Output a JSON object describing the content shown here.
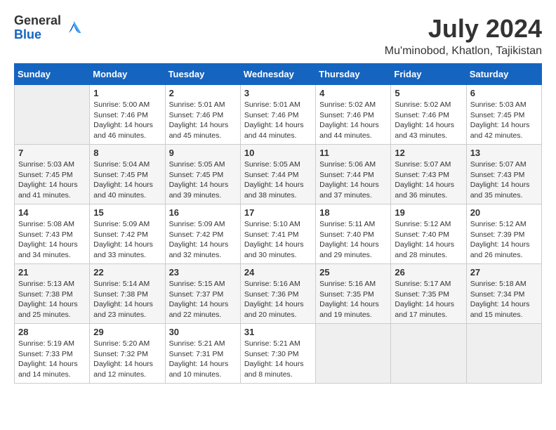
{
  "header": {
    "logo_general": "General",
    "logo_blue": "Blue",
    "month_year": "July 2024",
    "location": "Mu'minobod, Khatlon, Tajikistan"
  },
  "days_of_week": [
    "Sunday",
    "Monday",
    "Tuesday",
    "Wednesday",
    "Thursday",
    "Friday",
    "Saturday"
  ],
  "weeks": [
    [
      {
        "day": "",
        "empty": true
      },
      {
        "day": "1",
        "sunrise": "5:00 AM",
        "sunset": "7:46 PM",
        "daylight": "14 hours and 46 minutes."
      },
      {
        "day": "2",
        "sunrise": "5:01 AM",
        "sunset": "7:46 PM",
        "daylight": "14 hours and 45 minutes."
      },
      {
        "day": "3",
        "sunrise": "5:01 AM",
        "sunset": "7:46 PM",
        "daylight": "14 hours and 44 minutes."
      },
      {
        "day": "4",
        "sunrise": "5:02 AM",
        "sunset": "7:46 PM",
        "daylight": "14 hours and 44 minutes."
      },
      {
        "day": "5",
        "sunrise": "5:02 AM",
        "sunset": "7:46 PM",
        "daylight": "14 hours and 43 minutes."
      },
      {
        "day": "6",
        "sunrise": "5:03 AM",
        "sunset": "7:45 PM",
        "daylight": "14 hours and 42 minutes."
      }
    ],
    [
      {
        "day": "7",
        "sunrise": "5:03 AM",
        "sunset": "7:45 PM",
        "daylight": "14 hours and 41 minutes."
      },
      {
        "day": "8",
        "sunrise": "5:04 AM",
        "sunset": "7:45 PM",
        "daylight": "14 hours and 40 minutes."
      },
      {
        "day": "9",
        "sunrise": "5:05 AM",
        "sunset": "7:45 PM",
        "daylight": "14 hours and 39 minutes."
      },
      {
        "day": "10",
        "sunrise": "5:05 AM",
        "sunset": "7:44 PM",
        "daylight": "14 hours and 38 minutes."
      },
      {
        "day": "11",
        "sunrise": "5:06 AM",
        "sunset": "7:44 PM",
        "daylight": "14 hours and 37 minutes."
      },
      {
        "day": "12",
        "sunrise": "5:07 AM",
        "sunset": "7:43 PM",
        "daylight": "14 hours and 36 minutes."
      },
      {
        "day": "13",
        "sunrise": "5:07 AM",
        "sunset": "7:43 PM",
        "daylight": "14 hours and 35 minutes."
      }
    ],
    [
      {
        "day": "14",
        "sunrise": "5:08 AM",
        "sunset": "7:43 PM",
        "daylight": "14 hours and 34 minutes."
      },
      {
        "day": "15",
        "sunrise": "5:09 AM",
        "sunset": "7:42 PM",
        "daylight": "14 hours and 33 minutes."
      },
      {
        "day": "16",
        "sunrise": "5:09 AM",
        "sunset": "7:42 PM",
        "daylight": "14 hours and 32 minutes."
      },
      {
        "day": "17",
        "sunrise": "5:10 AM",
        "sunset": "7:41 PM",
        "daylight": "14 hours and 30 minutes."
      },
      {
        "day": "18",
        "sunrise": "5:11 AM",
        "sunset": "7:40 PM",
        "daylight": "14 hours and 29 minutes."
      },
      {
        "day": "19",
        "sunrise": "5:12 AM",
        "sunset": "7:40 PM",
        "daylight": "14 hours and 28 minutes."
      },
      {
        "day": "20",
        "sunrise": "5:12 AM",
        "sunset": "7:39 PM",
        "daylight": "14 hours and 26 minutes."
      }
    ],
    [
      {
        "day": "21",
        "sunrise": "5:13 AM",
        "sunset": "7:38 PM",
        "daylight": "14 hours and 25 minutes."
      },
      {
        "day": "22",
        "sunrise": "5:14 AM",
        "sunset": "7:38 PM",
        "daylight": "14 hours and 23 minutes."
      },
      {
        "day": "23",
        "sunrise": "5:15 AM",
        "sunset": "7:37 PM",
        "daylight": "14 hours and 22 minutes."
      },
      {
        "day": "24",
        "sunrise": "5:16 AM",
        "sunset": "7:36 PM",
        "daylight": "14 hours and 20 minutes."
      },
      {
        "day": "25",
        "sunrise": "5:16 AM",
        "sunset": "7:35 PM",
        "daylight": "14 hours and 19 minutes."
      },
      {
        "day": "26",
        "sunrise": "5:17 AM",
        "sunset": "7:35 PM",
        "daylight": "14 hours and 17 minutes."
      },
      {
        "day": "27",
        "sunrise": "5:18 AM",
        "sunset": "7:34 PM",
        "daylight": "14 hours and 15 minutes."
      }
    ],
    [
      {
        "day": "28",
        "sunrise": "5:19 AM",
        "sunset": "7:33 PM",
        "daylight": "14 hours and 14 minutes."
      },
      {
        "day": "29",
        "sunrise": "5:20 AM",
        "sunset": "7:32 PM",
        "daylight": "14 hours and 12 minutes."
      },
      {
        "day": "30",
        "sunrise": "5:21 AM",
        "sunset": "7:31 PM",
        "daylight": "14 hours and 10 minutes."
      },
      {
        "day": "31",
        "sunrise": "5:21 AM",
        "sunset": "7:30 PM",
        "daylight": "14 hours and 8 minutes."
      },
      {
        "day": "",
        "empty": true
      },
      {
        "day": "",
        "empty": true
      },
      {
        "day": "",
        "empty": true
      }
    ]
  ],
  "labels": {
    "sunrise_prefix": "Sunrise: ",
    "sunset_prefix": "Sunset: ",
    "daylight_prefix": "Daylight: "
  }
}
